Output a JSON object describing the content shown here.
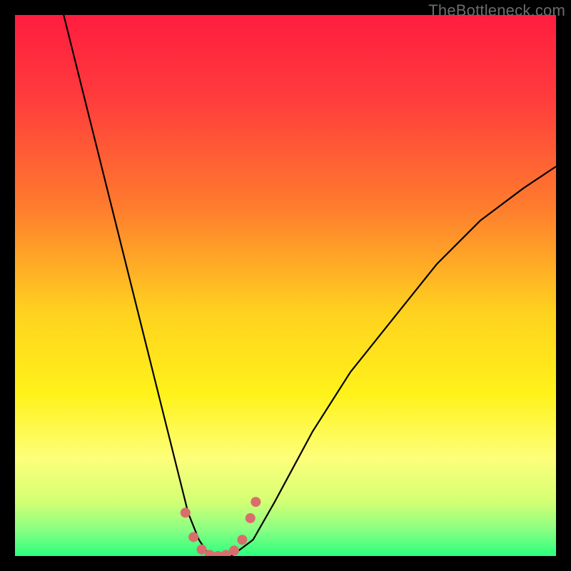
{
  "watermark": "TheBottleneck.com",
  "chart_data": {
    "type": "line",
    "title": "",
    "xlabel": "",
    "ylabel": "",
    "xlim": [
      0,
      100
    ],
    "ylim": [
      0,
      100
    ],
    "grid": false,
    "background_gradient": {
      "stops": [
        {
          "pos": 0.0,
          "color": "#ff1d3f"
        },
        {
          "pos": 0.15,
          "color": "#ff3b3d"
        },
        {
          "pos": 0.35,
          "color": "#ff7a2e"
        },
        {
          "pos": 0.55,
          "color": "#ffd21f"
        },
        {
          "pos": 0.7,
          "color": "#fff21a"
        },
        {
          "pos": 0.82,
          "color": "#fdff7a"
        },
        {
          "pos": 0.9,
          "color": "#d3ff74"
        },
        {
          "pos": 0.95,
          "color": "#8cff82"
        },
        {
          "pos": 1.0,
          "color": "#2bff7e"
        }
      ]
    },
    "series": [
      {
        "name": "bottleneck-curve",
        "x": [
          9,
          12,
          15,
          18,
          21,
          24,
          27,
          30,
          32,
          34,
          36,
          38,
          40,
          44,
          48,
          55,
          62,
          70,
          78,
          86,
          94,
          100
        ],
        "y": [
          100,
          88,
          76,
          64,
          52,
          40,
          28,
          16,
          8,
          3,
          0,
          0,
          0,
          3,
          10,
          23,
          34,
          44,
          54,
          62,
          68,
          72
        ],
        "color": "#000000",
        "width": 2.2
      },
      {
        "name": "optimal-zone-marker",
        "x": [
          31.5,
          33,
          34.5,
          36,
          37.5,
          39,
          40.5,
          42,
          43.5,
          44.5
        ],
        "y": [
          8,
          3.5,
          1.2,
          0.2,
          0,
          0.2,
          1.0,
          3.0,
          7.0,
          10.0
        ],
        "color": "#d96d6d",
        "width": 14,
        "dotted": true
      }
    ]
  }
}
